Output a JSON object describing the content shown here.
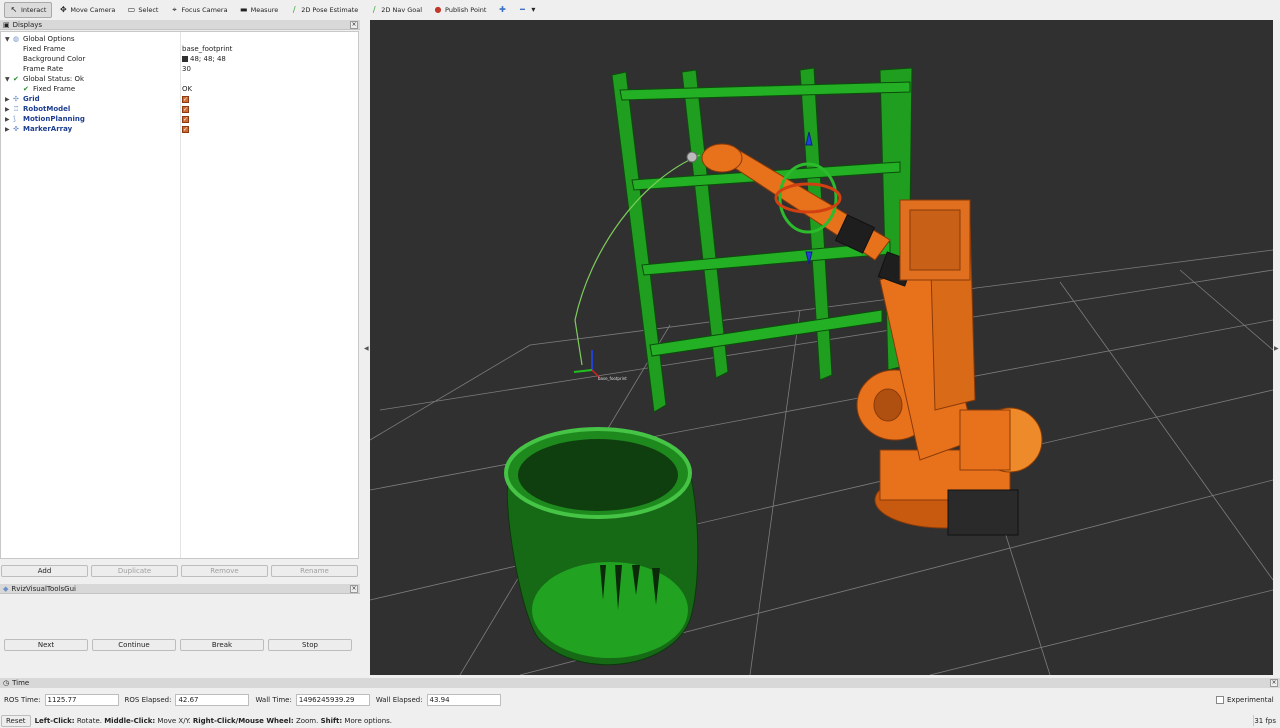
{
  "toolbar": {
    "tools": [
      {
        "label": "Interact",
        "icon": "cursor-icon"
      },
      {
        "label": "Move Camera",
        "icon": "move-camera-icon"
      },
      {
        "label": "Select",
        "icon": "select-icon"
      },
      {
        "label": "Focus Camera",
        "icon": "focus-camera-icon"
      },
      {
        "label": "Measure",
        "icon": "measure-icon"
      },
      {
        "label": "2D Pose Estimate",
        "icon": "pose-estimate-icon"
      },
      {
        "label": "2D Nav Goal",
        "icon": "nav-goal-icon"
      },
      {
        "label": "Publish Point",
        "icon": "publish-point-icon"
      }
    ]
  },
  "displays": {
    "title": "Displays",
    "tree": {
      "global_options": "Global Options",
      "fixed_frame_label": "Fixed Frame",
      "fixed_frame_value": "base_footprint",
      "background_color_label": "Background Color",
      "background_color_value": "48; 48; 48",
      "frame_rate_label": "Frame Rate",
      "frame_rate_value": "30",
      "global_status": "Global Status: Ok",
      "status_fixed_frame_label": "Fixed Frame",
      "status_fixed_frame_value": "OK",
      "grid": "Grid",
      "robot_model": "RobotModel",
      "motion_planning": "MotionPlanning",
      "marker_array": "MarkerArray"
    },
    "buttons": {
      "add": "Add",
      "duplicate": "Duplicate",
      "remove": "Remove",
      "rename": "Rename"
    }
  },
  "rviz_gui": {
    "title": "RvizVisualToolsGui",
    "buttons": {
      "next": "Next",
      "continue": "Continue",
      "break": "Break",
      "stop": "Stop"
    }
  },
  "time": {
    "title": "Time",
    "ros_time_label": "ROS Time:",
    "ros_time": "1125.77",
    "ros_elapsed_label": "ROS Elapsed:",
    "ros_elapsed": "42.67",
    "wall_time_label": "Wall Time:",
    "wall_time": "1496245939.29",
    "wall_elapsed_label": "Wall Elapsed:",
    "wall_elapsed": "43.94",
    "experimental": "Experimental"
  },
  "status": {
    "reset": "Reset",
    "left_click": "Left-Click:",
    "left_click_desc": " Rotate. ",
    "middle_click": "Middle-Click:",
    "middle_click_desc": " Move X/Y. ",
    "right_click": "Right-Click/Mouse Wheel:",
    "right_click_desc": " Zoom. ",
    "shift": "Shift:",
    "shift_desc": " More options.",
    "fps": "31 fps"
  },
  "scene": {
    "background": "#303030",
    "robot_color": "#e8721c",
    "shelf_color": "#22b322",
    "grid_color": "#9a9a9a",
    "axis_label": "base_footprint"
  }
}
